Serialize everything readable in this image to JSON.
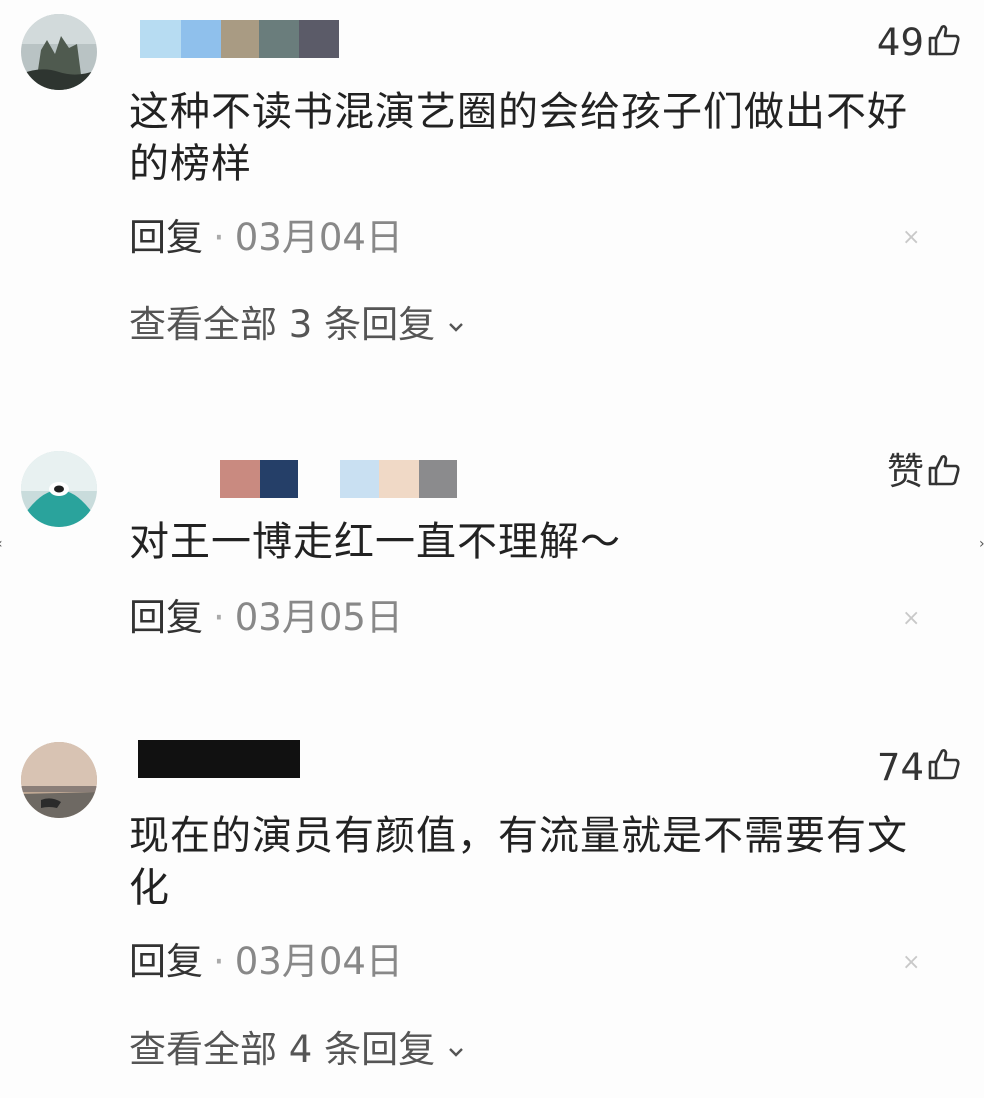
{
  "comments": [
    {
      "likes": "49",
      "text": "这种不读书混演艺圈的会给孩子们做出不好的榜样",
      "reply_label": "回复",
      "separator": "·",
      "date": "03月04日",
      "view_replies": "查看全部 3 条回复",
      "close": "×"
    },
    {
      "likes": "赞",
      "text": "对王一博走红一直不理解～",
      "reply_label": "回复",
      "separator": "·",
      "date": "03月05日",
      "close": "×"
    },
    {
      "likes": "74",
      "text": "现在的演员有颜值，有流量就是不需要有文化",
      "reply_label": "回复",
      "separator": "·",
      "date": "03月04日",
      "view_replies": "查看全部 4 条回复",
      "close": "×"
    }
  ],
  "icons": {
    "like": "thumbs-up-icon",
    "expand": "chevron-down-icon",
    "close": "close-icon"
  },
  "colors": {
    "name_blocks_1": [
      "#b7dcf2",
      "#8fc0ec",
      "#a99b83",
      "#6a7d7c",
      "#5b5b68"
    ],
    "name_blocks_2": [
      "#c98a80",
      "#253f68",
      "#c9e0f2",
      "#f0d9c6",
      "#8b8b8d"
    ],
    "name_block_3": "#111111"
  }
}
